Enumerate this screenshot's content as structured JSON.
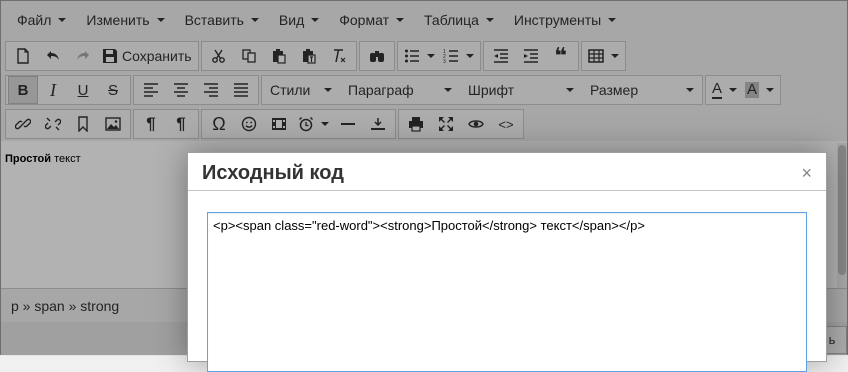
{
  "menubar": {
    "items": [
      {
        "label": "Файл"
      },
      {
        "label": "Изменить"
      },
      {
        "label": "Вставить"
      },
      {
        "label": "Вид"
      },
      {
        "label": "Формат"
      },
      {
        "label": "Таблица"
      },
      {
        "label": "Инструменты"
      }
    ]
  },
  "toolbar": {
    "save_label": "Сохранить",
    "styles_label": "Стили",
    "paragraph_label": "Параграф",
    "font_label": "Шрифт",
    "size_label": "Размер",
    "font_color_glyph": "A",
    "bg_color_glyph": "A",
    "bold_glyph": "B",
    "italic_glyph": "I",
    "underline_glyph": "U",
    "strike_glyph": "S",
    "quote_glyph": "❝",
    "omega_glyph": "Ω",
    "code_glyph": "<>"
  },
  "editor": {
    "content_bold": "Простой",
    "content_rest": " текст",
    "path": "p » span » strong",
    "bottom_button": "ь"
  },
  "dialog": {
    "title": "Исходный код",
    "close": "×",
    "code": "<p><span class=\"red-word\"><strong>Простой</strong> текст</span></p>"
  }
}
